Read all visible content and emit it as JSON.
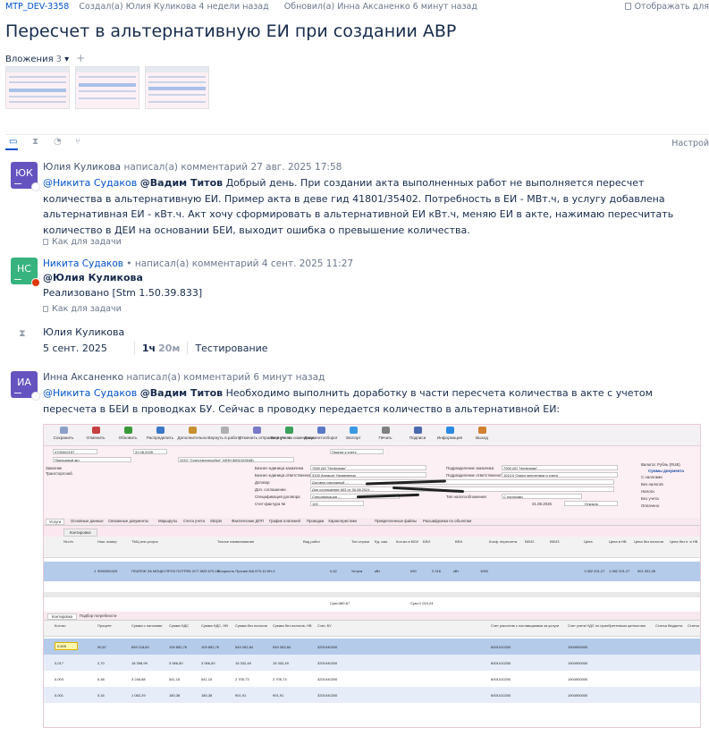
{
  "header": {
    "issue_key": "MTP_DEV-3358",
    "created": "Создал(а) Юлия Куликова 4 недели назад",
    "updated": "Обновил(а) Инна Аксаненко 6 минут назад",
    "visibility": "Отображать для"
  },
  "title": "Пересчет в альтернативную ЕИ при создании АВР",
  "attachments": {
    "label": "Вложения",
    "count": "3",
    "chevron": "▾",
    "add": "+"
  },
  "activity": {
    "settings": "Настрой"
  },
  "comments": [
    {
      "initials": "ЮК",
      "author": "Юлия Куликова",
      "action": " написал(а) комментарий 27 авг. 2025 17:58",
      "mention1": "@Никита Судаков",
      "mention2": "@Вадим Титов",
      "text": " Добрый день. При создании акта выполненных работ не выполняется пересчет количества в альтернативную ЕИ. Пример акта в деве гид 41801/35402. Потребность в ЕИ - МВт.ч, в услугу добавлена альтернативная ЕИ - кВт.ч. Акт хочу сформировать в альтернативной ЕИ кВт.ч, меняю ЕИ в акте, нажимаю пересчитать количество в ДЕИ на основании БЕИ, выходит ошибка о превышение количества.",
      "visibility": "Как для задачи"
    },
    {
      "initials": "НС",
      "author": "Никита Судаков",
      "action": " • написал(а) комментарий 4 сент. 2025 11:27",
      "mention": "@Юлия Куликова",
      "text": "Реализовано [Stm 1.50.39.833]",
      "visibility": "Как для задачи"
    },
    {
      "initials": "ИА",
      "author": "Инна Аксаненко",
      "action": " написал(а) комментарий 6 минут назад",
      "mention1": "@Никита Судаков",
      "mention2": "@Вадим Титов",
      "text": " Необходимо выполнить доработку в части пересчета количества в акте с учетом пересчета в БЕИ в проводках БУ. Сейчас в проводку передается количество в альтернативной ЕИ:"
    }
  ],
  "worklog": {
    "author": "Юлия Куликова",
    "date": "5 сент. 2025",
    "hours": "1ч",
    "minutes": "20м",
    "activity": "Тестирование"
  },
  "screenshot": {
    "toolbar": [
      "Сохранить",
      "Отменить",
      "Обновить",
      "Распределить",
      "Дополнительно",
      "Вернуть в работу",
      "Отменить отправки в учете",
      "Вернуть на изменение",
      "Документооборот",
      "Экспорт",
      "Печать",
      "Подписи",
      "Информация",
      "Выход"
    ],
    "doc_no": "4700002157",
    "date1": "31.08.2025",
    "status": "Принят к учету",
    "type": "Приходный акт",
    "supplier": "ООО \"Сургутэнергосбыт\" (ИНН 8602153048)",
    "fields_left": [
      "Заказчик",
      "Трансторгснаб"
    ],
    "fields_mid": [
      "Бизнес-единица заказчика",
      "Бизнес-единица ответственного",
      "Договор",
      "Доп. соглашение",
      "Спецификация договора",
      "Счет-фактура №"
    ],
    "fields_mid_vals": [
      "7000  ДО \"Нефтяник\"",
      "3100  Аппарат Управления",
      "Договор расходный ...",
      "Доп.соглашение 603 от 30.08.2024 ...",
      "Спецификация ...",
      "100"
    ],
    "fields_right": [
      "Подразделение заказчика",
      "Подразделение ответственного",
      "Тип налогообложения"
    ],
    "fields_right_vals": [
      "7000  ДО \"Нефтяник\"",
      "1013.0  Отдел энергетики и учета",
      "С налогами"
    ],
    "sums": [
      "Валюта: Рубль (RUB)",
      "Суммы документа",
      "С налогами",
      "Без налогов",
      "Налоги",
      "Без учета",
      "Оплачено"
    ],
    "date2": "31.08.2025",
    "open_btn": "Открыть",
    "tabs": [
      "Услуги",
      "Основные данные",
      "Связанные документы",
      "Маршруты",
      "Счета учета",
      "Skripts",
      "Фактические ДПП",
      "График платежей",
      "Проводки",
      "Характеристики",
      "Прикрепленные файлы",
      "Расшифровка по объектам"
    ],
    "kontrola": "Контировка",
    "grid1_headers": [
      "№ п/п",
      "Ном. номер",
      "ТМЦ или услуга",
      "Точное наименование",
      "Вид работ",
      "Тип строки",
      "Ед. изм.",
      "Кол-во в БЕИ",
      "БЕИ",
      "ВЕИ",
      "Коэф. пересчета",
      "ВЕИ2",
      "ВЕИ3",
      "Цена",
      "Цена в НВ",
      "Цена без налогов",
      "Цена без н. в НВ"
    ],
    "grid1_row": [
      "1",
      "9000000429",
      "ПЛАТЕЖ ЗА МОЩН ПРОЧ ПОТРЕБ 2СТ 5МЗ 670-10",
      "Мощность Прочие 6Ш 670-10 6Н-3",
      "0,42",
      "Услуга",
      "кВт",
      "630",
      "2 016",
      "кВт",
      "1000",
      "1 082 201,27",
      "1 082 201,27",
      "901 931,06"
    ],
    "totals": [
      "Сум=380,67",
      "Сум=1 010,24"
    ],
    "tabs2": [
      "Контировка",
      "Подбор потребности"
    ],
    "grid2_headers": [
      "Кол-во",
      "Процент",
      "Сумма с налогами",
      "Сумма НДС",
      "Сумма НДС, НВ",
      "Сумма без налогов",
      "Сумма без налогов, НВ",
      "Счет, БУ",
      "Счет расчетов с поставщиками за услуги",
      "Счет учета НДС по приобретенным ценностям",
      "Статья бюджета",
      "Статья"
    ],
    "grid2_rows": [
      [
        "0,609",
        "90,67",
        "659 118,60",
        "109 852,76",
        "109 852,76",
        "549 262,84",
        "549 263,84",
        "3201040200",
        "6001010200",
        "1904000000"
      ],
      [
        "0,017",
        "2,70",
        "18 398,99",
        "3 066,50",
        "3 066,50",
        "15 332,49",
        "15 332,49",
        "3201040200",
        "6001010200",
        "1904000000"
      ],
      [
        "0,003",
        "0,48",
        "3 246,88",
        "541,15",
        "541,15",
        "2 705,73",
        "2 705,73",
        "3201040200",
        "6001010200",
        "1904000000"
      ],
      [
        "0,001",
        "0,16",
        "1 082,29",
        "180,38",
        "180,38",
        "901,91",
        "901,91",
        "3201040200",
        "6001010200",
        "1904000000"
      ]
    ]
  }
}
